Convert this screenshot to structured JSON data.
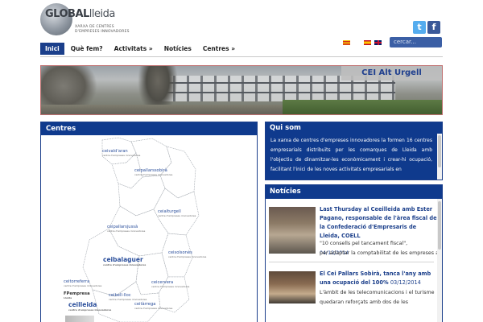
{
  "logo": {
    "word_global": "GLOBAL",
    "word_lleida": "lleida",
    "subtitle_line1": "XARXA DE CENTRES",
    "subtitle_line2": "D'EMPRESES INNOVADORES"
  },
  "social": {
    "twitter_icon": "twitter-icon",
    "facebook_icon": "facebook-icon"
  },
  "languages": [
    "catalan-flag",
    "spanish-flag",
    "english-flag"
  ],
  "search": {
    "placeholder": "cercar..."
  },
  "nav": {
    "items": [
      {
        "label": "Inici",
        "active": true
      },
      {
        "label": "Què fem?",
        "active": false
      },
      {
        "label": "Activitats »",
        "active": false
      },
      {
        "label": "Notícies",
        "active": false
      },
      {
        "label": "Centres »",
        "active": false
      }
    ]
  },
  "banner": {
    "label": "CEI Alt Urgell"
  },
  "centres": {
    "title": "Centres",
    "labels": [
      {
        "name": "ceivald'aran",
        "sub": "centre d'empreses innovadores"
      },
      {
        "name": "ceipallarssobirà",
        "sub": "centre d'empreses innovadores"
      },
      {
        "name": "ceialturgell",
        "sub": "centre d'empreses innovadores"
      },
      {
        "name": "ceipallarsjussà",
        "sub": "centre d'empreses innovadores"
      },
      {
        "name": "ceibalaguer",
        "sub": "centre d'empreses innovadores"
      },
      {
        "name": "ceisolsonès",
        "sub": "centre d'empreses innovadores"
      },
      {
        "name": "ceicervera",
        "sub": "centre d'empreses innovadores"
      },
      {
        "name": "ceitorreferra",
        "sub": "centre d'empreses innovadores"
      },
      {
        "name": "ceibell-lloc",
        "sub": "centre d'empreses innovadores"
      },
      {
        "name": "FPempresa",
        "sub": "Lleida"
      },
      {
        "name": "ceilleida",
        "sub": "centre d'empreses innovadores"
      },
      {
        "name": "ceitàrrega",
        "sub": "centre d'empreses innovadores"
      }
    ]
  },
  "qui_som": {
    "title": "Qui som",
    "text": "La xarxa de centres d'empreses innovadores la formen 16 centres empresarials distribuïts per les comarques de Lleida amb l'objectiu de dinamitzar-les econòmicament i crear-hi ocupació, facilitant l'inici de les noves activitats empresarials en"
  },
  "noticies": {
    "title": "Notícies",
    "items": [
      {
        "title": "Last Thursday al Ceeilleida amb Ester Pagano, responsable de l'àrea fiscal de la Confederació d'Empresaris de Lleida, COELL",
        "excerpt": "\"10 consells pel tancament fiscal\",",
        "date": "04/12/2014",
        "excerpt2": "per adaptar la comptabilitat de les empreses a"
      },
      {
        "title": "El Cei Pallars Sobirà, tanca l'any amb una ocupació del 100%",
        "date": "03/12/2014",
        "excerpt": "L'àmbit de les telecomunicacions i el turisme quedaran reforçats amb dos de les"
      }
    ]
  },
  "colors": {
    "primary": "#0f3a8d",
    "nav_active": "#1b3f8b",
    "search_bg": "#3b5fa5",
    "twitter": "#55acee",
    "facebook": "#3b5998"
  }
}
